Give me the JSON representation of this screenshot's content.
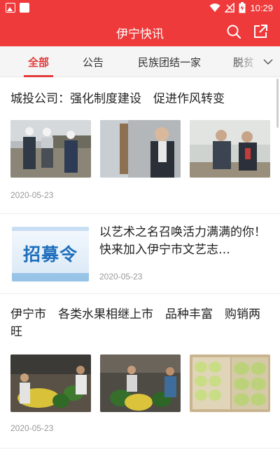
{
  "status_bar": {
    "time": "10:29",
    "left_icons": [
      "image-icon",
      "square-icon"
    ],
    "right_icons": [
      "wifi-icon",
      "no-signal-icon",
      "battery-charging-icon"
    ]
  },
  "app_bar": {
    "title": "伊宁快讯",
    "icons": [
      "search-icon",
      "share-icon"
    ]
  },
  "tabs": [
    {
      "label": "全部",
      "active": true
    },
    {
      "label": "公告",
      "active": false
    },
    {
      "label": "民族团结一家",
      "active": false
    },
    {
      "label": "脱贫",
      "active": false
    }
  ],
  "tabs_more_icon": "chevron-down-icon",
  "articles": [
    {
      "title": "城投公司：强化制度建设　促进作风转变",
      "date": "2020-05-23",
      "images": [
        "construction site inspection photo",
        "office meeting photo",
        "office desk discussion photo"
      ]
    },
    {
      "title": "以艺术之名召唤活力满满的你！　快来加入伊宁市文艺志…",
      "date": "2020-05-23",
      "thumb_text": "招募令"
    },
    {
      "title": "伊宁市　各类水果相继上市　品种丰富　购销两旺",
      "date": "2020-05-23",
      "images": [
        "watermelon market photo",
        "watermelon stall photo",
        "melon box photo"
      ]
    }
  ],
  "colors": {
    "brand_red": "#ee3a3a",
    "tab_active": "#e23b3b",
    "date_gray": "#999999"
  }
}
